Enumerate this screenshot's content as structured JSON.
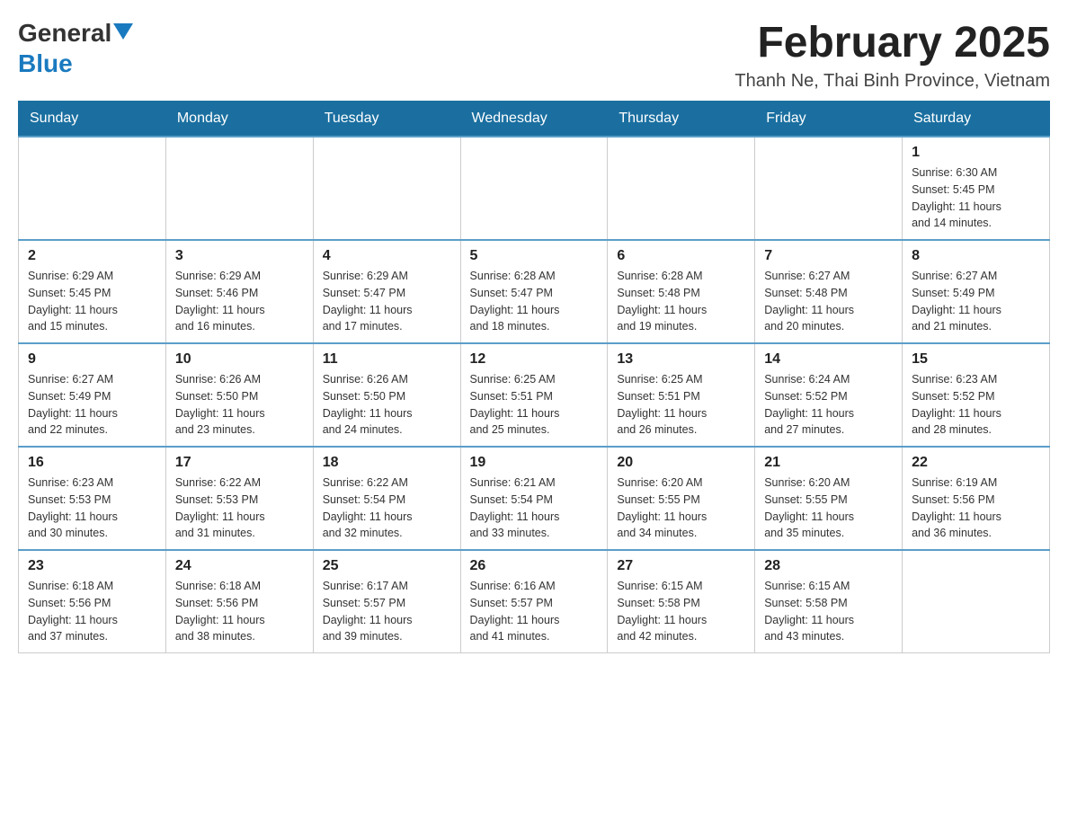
{
  "header": {
    "logo_general": "General",
    "logo_blue": "Blue",
    "title": "February 2025",
    "subtitle": "Thanh Ne, Thai Binh Province, Vietnam"
  },
  "days_of_week": [
    "Sunday",
    "Monday",
    "Tuesday",
    "Wednesday",
    "Thursday",
    "Friday",
    "Saturday"
  ],
  "weeks": [
    {
      "days": [
        {
          "num": "",
          "info": ""
        },
        {
          "num": "",
          "info": ""
        },
        {
          "num": "",
          "info": ""
        },
        {
          "num": "",
          "info": ""
        },
        {
          "num": "",
          "info": ""
        },
        {
          "num": "",
          "info": ""
        },
        {
          "num": "1",
          "info": "Sunrise: 6:30 AM\nSunset: 5:45 PM\nDaylight: 11 hours\nand 14 minutes."
        }
      ]
    },
    {
      "days": [
        {
          "num": "2",
          "info": "Sunrise: 6:29 AM\nSunset: 5:45 PM\nDaylight: 11 hours\nand 15 minutes."
        },
        {
          "num": "3",
          "info": "Sunrise: 6:29 AM\nSunset: 5:46 PM\nDaylight: 11 hours\nand 16 minutes."
        },
        {
          "num": "4",
          "info": "Sunrise: 6:29 AM\nSunset: 5:47 PM\nDaylight: 11 hours\nand 17 minutes."
        },
        {
          "num": "5",
          "info": "Sunrise: 6:28 AM\nSunset: 5:47 PM\nDaylight: 11 hours\nand 18 minutes."
        },
        {
          "num": "6",
          "info": "Sunrise: 6:28 AM\nSunset: 5:48 PM\nDaylight: 11 hours\nand 19 minutes."
        },
        {
          "num": "7",
          "info": "Sunrise: 6:27 AM\nSunset: 5:48 PM\nDaylight: 11 hours\nand 20 minutes."
        },
        {
          "num": "8",
          "info": "Sunrise: 6:27 AM\nSunset: 5:49 PM\nDaylight: 11 hours\nand 21 minutes."
        }
      ]
    },
    {
      "days": [
        {
          "num": "9",
          "info": "Sunrise: 6:27 AM\nSunset: 5:49 PM\nDaylight: 11 hours\nand 22 minutes."
        },
        {
          "num": "10",
          "info": "Sunrise: 6:26 AM\nSunset: 5:50 PM\nDaylight: 11 hours\nand 23 minutes."
        },
        {
          "num": "11",
          "info": "Sunrise: 6:26 AM\nSunset: 5:50 PM\nDaylight: 11 hours\nand 24 minutes."
        },
        {
          "num": "12",
          "info": "Sunrise: 6:25 AM\nSunset: 5:51 PM\nDaylight: 11 hours\nand 25 minutes."
        },
        {
          "num": "13",
          "info": "Sunrise: 6:25 AM\nSunset: 5:51 PM\nDaylight: 11 hours\nand 26 minutes."
        },
        {
          "num": "14",
          "info": "Sunrise: 6:24 AM\nSunset: 5:52 PM\nDaylight: 11 hours\nand 27 minutes."
        },
        {
          "num": "15",
          "info": "Sunrise: 6:23 AM\nSunset: 5:52 PM\nDaylight: 11 hours\nand 28 minutes."
        }
      ]
    },
    {
      "days": [
        {
          "num": "16",
          "info": "Sunrise: 6:23 AM\nSunset: 5:53 PM\nDaylight: 11 hours\nand 30 minutes."
        },
        {
          "num": "17",
          "info": "Sunrise: 6:22 AM\nSunset: 5:53 PM\nDaylight: 11 hours\nand 31 minutes."
        },
        {
          "num": "18",
          "info": "Sunrise: 6:22 AM\nSunset: 5:54 PM\nDaylight: 11 hours\nand 32 minutes."
        },
        {
          "num": "19",
          "info": "Sunrise: 6:21 AM\nSunset: 5:54 PM\nDaylight: 11 hours\nand 33 minutes."
        },
        {
          "num": "20",
          "info": "Sunrise: 6:20 AM\nSunset: 5:55 PM\nDaylight: 11 hours\nand 34 minutes."
        },
        {
          "num": "21",
          "info": "Sunrise: 6:20 AM\nSunset: 5:55 PM\nDaylight: 11 hours\nand 35 minutes."
        },
        {
          "num": "22",
          "info": "Sunrise: 6:19 AM\nSunset: 5:56 PM\nDaylight: 11 hours\nand 36 minutes."
        }
      ]
    },
    {
      "days": [
        {
          "num": "23",
          "info": "Sunrise: 6:18 AM\nSunset: 5:56 PM\nDaylight: 11 hours\nand 37 minutes."
        },
        {
          "num": "24",
          "info": "Sunrise: 6:18 AM\nSunset: 5:56 PM\nDaylight: 11 hours\nand 38 minutes."
        },
        {
          "num": "25",
          "info": "Sunrise: 6:17 AM\nSunset: 5:57 PM\nDaylight: 11 hours\nand 39 minutes."
        },
        {
          "num": "26",
          "info": "Sunrise: 6:16 AM\nSunset: 5:57 PM\nDaylight: 11 hours\nand 41 minutes."
        },
        {
          "num": "27",
          "info": "Sunrise: 6:15 AM\nSunset: 5:58 PM\nDaylight: 11 hours\nand 42 minutes."
        },
        {
          "num": "28",
          "info": "Sunrise: 6:15 AM\nSunset: 5:58 PM\nDaylight: 11 hours\nand 43 minutes."
        },
        {
          "num": "",
          "info": ""
        }
      ]
    }
  ]
}
